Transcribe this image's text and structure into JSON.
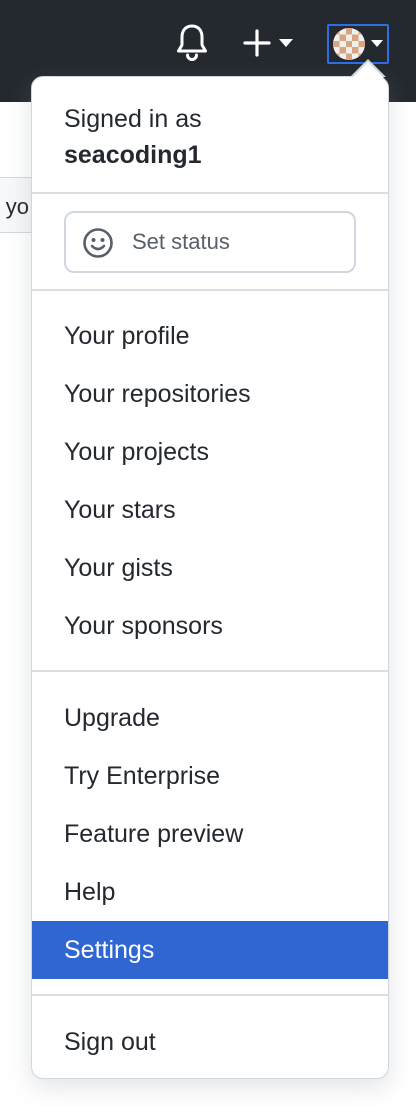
{
  "header": {
    "notifications_icon": "bell-icon",
    "create_icon": "plus-icon",
    "avatar_icon": "identicon-avatar"
  },
  "background": {
    "partial_text": "o yo"
  },
  "menu": {
    "signed_in_prefix": "Signed in as",
    "username": "seacoding1",
    "status_button_label": "Set status",
    "status_icon": "smiley-icon",
    "group1": [
      "Your profile",
      "Your repositories",
      "Your projects",
      "Your stars",
      "Your gists",
      "Your sponsors"
    ],
    "group2": [
      "Upgrade",
      "Try Enterprise",
      "Feature preview",
      "Help",
      "Settings"
    ],
    "sign_out": "Sign out",
    "active_item": "Settings"
  },
  "colors": {
    "header_bg": "#24292f",
    "active_bg": "#2f66d2",
    "focus_ring": "#2f6ee0",
    "border": "#d0d7de"
  }
}
